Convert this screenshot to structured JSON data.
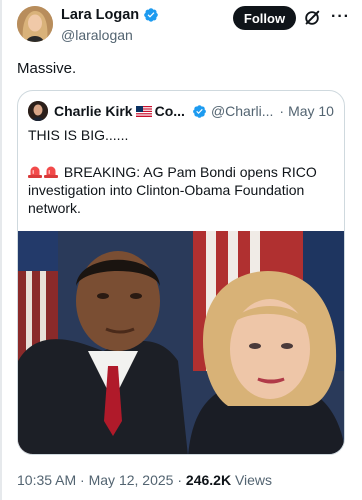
{
  "author": {
    "display_name": "Lara Logan",
    "handle": "@laralogan",
    "verified": true
  },
  "actions": {
    "follow_label": "Follow",
    "grok_icon": "grok-icon",
    "more_icon": "more-icon"
  },
  "tweet": {
    "text": "Massive."
  },
  "quote": {
    "author_name": "Charlie Kirk",
    "author_name_suffix": "Co...",
    "handle": "@Charli...",
    "separator": "·",
    "date": "May 10",
    "line1": "THIS IS BIG......",
    "body": "BREAKING: AG Pam Bondi opens RICO investigation into Clinton-Obama Foundation network.",
    "body_icons": [
      "siren-icon",
      "siren-icon"
    ]
  },
  "meta": {
    "time": "10:35 AM",
    "sep1": "·",
    "date": "May 12, 2025",
    "sep2": "·",
    "views_count": "246.2K",
    "views_label": "Views"
  },
  "colors": {
    "verified_blue": "#1d9bf0",
    "text_primary": "#0f1419",
    "text_secondary": "#536471",
    "border": "#cfd9de"
  }
}
